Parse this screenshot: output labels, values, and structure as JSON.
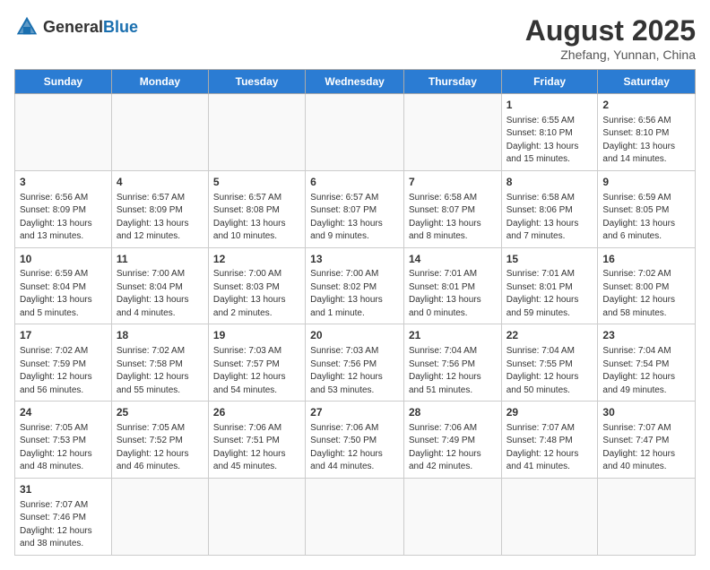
{
  "header": {
    "logo_general": "General",
    "logo_blue": "Blue",
    "month_year": "August 2025",
    "location": "Zhefang, Yunnan, China"
  },
  "weekdays": [
    "Sunday",
    "Monday",
    "Tuesday",
    "Wednesday",
    "Thursday",
    "Friday",
    "Saturday"
  ],
  "weeks": [
    [
      {
        "day": "",
        "info": ""
      },
      {
        "day": "",
        "info": ""
      },
      {
        "day": "",
        "info": ""
      },
      {
        "day": "",
        "info": ""
      },
      {
        "day": "",
        "info": ""
      },
      {
        "day": "1",
        "info": "Sunrise: 6:55 AM\nSunset: 8:10 PM\nDaylight: 13 hours and 15 minutes."
      },
      {
        "day": "2",
        "info": "Sunrise: 6:56 AM\nSunset: 8:10 PM\nDaylight: 13 hours and 14 minutes."
      }
    ],
    [
      {
        "day": "3",
        "info": "Sunrise: 6:56 AM\nSunset: 8:09 PM\nDaylight: 13 hours and 13 minutes."
      },
      {
        "day": "4",
        "info": "Sunrise: 6:57 AM\nSunset: 8:09 PM\nDaylight: 13 hours and 12 minutes."
      },
      {
        "day": "5",
        "info": "Sunrise: 6:57 AM\nSunset: 8:08 PM\nDaylight: 13 hours and 10 minutes."
      },
      {
        "day": "6",
        "info": "Sunrise: 6:57 AM\nSunset: 8:07 PM\nDaylight: 13 hours and 9 minutes."
      },
      {
        "day": "7",
        "info": "Sunrise: 6:58 AM\nSunset: 8:07 PM\nDaylight: 13 hours and 8 minutes."
      },
      {
        "day": "8",
        "info": "Sunrise: 6:58 AM\nSunset: 8:06 PM\nDaylight: 13 hours and 7 minutes."
      },
      {
        "day": "9",
        "info": "Sunrise: 6:59 AM\nSunset: 8:05 PM\nDaylight: 13 hours and 6 minutes."
      }
    ],
    [
      {
        "day": "10",
        "info": "Sunrise: 6:59 AM\nSunset: 8:04 PM\nDaylight: 13 hours and 5 minutes."
      },
      {
        "day": "11",
        "info": "Sunrise: 7:00 AM\nSunset: 8:04 PM\nDaylight: 13 hours and 4 minutes."
      },
      {
        "day": "12",
        "info": "Sunrise: 7:00 AM\nSunset: 8:03 PM\nDaylight: 13 hours and 2 minutes."
      },
      {
        "day": "13",
        "info": "Sunrise: 7:00 AM\nSunset: 8:02 PM\nDaylight: 13 hours and 1 minute."
      },
      {
        "day": "14",
        "info": "Sunrise: 7:01 AM\nSunset: 8:01 PM\nDaylight: 13 hours and 0 minutes."
      },
      {
        "day": "15",
        "info": "Sunrise: 7:01 AM\nSunset: 8:01 PM\nDaylight: 12 hours and 59 minutes."
      },
      {
        "day": "16",
        "info": "Sunrise: 7:02 AM\nSunset: 8:00 PM\nDaylight: 12 hours and 58 minutes."
      }
    ],
    [
      {
        "day": "17",
        "info": "Sunrise: 7:02 AM\nSunset: 7:59 PM\nDaylight: 12 hours and 56 minutes."
      },
      {
        "day": "18",
        "info": "Sunrise: 7:02 AM\nSunset: 7:58 PM\nDaylight: 12 hours and 55 minutes."
      },
      {
        "day": "19",
        "info": "Sunrise: 7:03 AM\nSunset: 7:57 PM\nDaylight: 12 hours and 54 minutes."
      },
      {
        "day": "20",
        "info": "Sunrise: 7:03 AM\nSunset: 7:56 PM\nDaylight: 12 hours and 53 minutes."
      },
      {
        "day": "21",
        "info": "Sunrise: 7:04 AM\nSunset: 7:56 PM\nDaylight: 12 hours and 51 minutes."
      },
      {
        "day": "22",
        "info": "Sunrise: 7:04 AM\nSunset: 7:55 PM\nDaylight: 12 hours and 50 minutes."
      },
      {
        "day": "23",
        "info": "Sunrise: 7:04 AM\nSunset: 7:54 PM\nDaylight: 12 hours and 49 minutes."
      }
    ],
    [
      {
        "day": "24",
        "info": "Sunrise: 7:05 AM\nSunset: 7:53 PM\nDaylight: 12 hours and 48 minutes."
      },
      {
        "day": "25",
        "info": "Sunrise: 7:05 AM\nSunset: 7:52 PM\nDaylight: 12 hours and 46 minutes."
      },
      {
        "day": "26",
        "info": "Sunrise: 7:06 AM\nSunset: 7:51 PM\nDaylight: 12 hours and 45 minutes."
      },
      {
        "day": "27",
        "info": "Sunrise: 7:06 AM\nSunset: 7:50 PM\nDaylight: 12 hours and 44 minutes."
      },
      {
        "day": "28",
        "info": "Sunrise: 7:06 AM\nSunset: 7:49 PM\nDaylight: 12 hours and 42 minutes."
      },
      {
        "day": "29",
        "info": "Sunrise: 7:07 AM\nSunset: 7:48 PM\nDaylight: 12 hours and 41 minutes."
      },
      {
        "day": "30",
        "info": "Sunrise: 7:07 AM\nSunset: 7:47 PM\nDaylight: 12 hours and 40 minutes."
      }
    ],
    [
      {
        "day": "31",
        "info": "Sunrise: 7:07 AM\nSunset: 7:46 PM\nDaylight: 12 hours and 38 minutes."
      },
      {
        "day": "",
        "info": ""
      },
      {
        "day": "",
        "info": ""
      },
      {
        "day": "",
        "info": ""
      },
      {
        "day": "",
        "info": ""
      },
      {
        "day": "",
        "info": ""
      },
      {
        "day": "",
        "info": ""
      }
    ]
  ]
}
